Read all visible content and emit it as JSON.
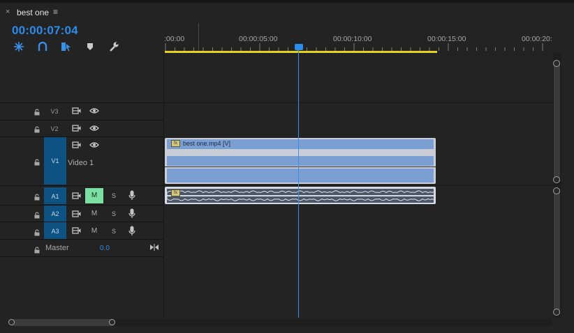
{
  "panel": {
    "close_glyph": "×",
    "title": "best one",
    "menu_glyph": "≡",
    "timecode": "00:00:07:04"
  },
  "toolbar": {
    "tools": [
      {
        "name": "nest-sequence-icon"
      },
      {
        "name": "snap-icon"
      },
      {
        "name": "linked-selection-icon"
      },
      {
        "name": "add-marker-icon"
      },
      {
        "name": "settings-wrench-icon"
      }
    ]
  },
  "ruler": {
    "labels": [
      ":00:00",
      "00:00:05:00",
      "00:00:10:00",
      "00:00:15:00",
      "00:00:20:"
    ]
  },
  "tracks": {
    "v3": {
      "label": "V3"
    },
    "v2": {
      "label": "V2"
    },
    "v1": {
      "label": "V1",
      "name": "Video 1"
    },
    "a1": {
      "label": "A1",
      "mute": "M",
      "solo": "S"
    },
    "a2": {
      "label": "A2",
      "mute": "M",
      "solo": "S"
    },
    "a3": {
      "label": "A3",
      "mute": "M",
      "solo": "S"
    },
    "master": {
      "name": "Master",
      "value": "0.0"
    }
  },
  "clips": {
    "video": {
      "fx": "fx",
      "name": "best one.mp4 [V]"
    },
    "audio": {
      "fx": "fx"
    }
  },
  "colors": {
    "accent": "#2d8ceb",
    "target": "#0c5282",
    "mute_active": "#7ce0a4",
    "work_area": "#e6d319",
    "video_clip": "#7b9fd3"
  }
}
